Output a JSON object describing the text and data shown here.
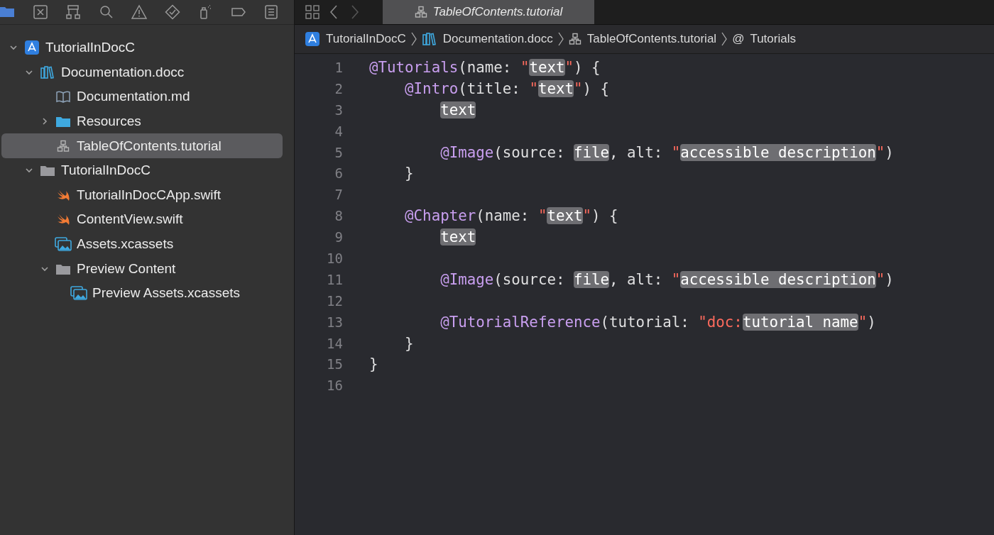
{
  "navigator_toolbar": [
    {
      "kind": "folder",
      "selected": true
    },
    {
      "kind": "source-control",
      "selected": false
    },
    {
      "kind": "hierarchy",
      "selected": false
    },
    {
      "kind": "search",
      "selected": false
    },
    {
      "kind": "warning",
      "selected": false
    },
    {
      "kind": "test",
      "selected": false
    },
    {
      "kind": "debug",
      "selected": false
    },
    {
      "kind": "breakpoint",
      "selected": false
    },
    {
      "kind": "report",
      "selected": false
    }
  ],
  "tree": [
    {
      "label": "TutorialInDocC",
      "kind": "project",
      "expanded": true,
      "selected": false,
      "children": [
        {
          "label": "Documentation.docc",
          "kind": "docc",
          "expanded": true,
          "selected": false,
          "children": [
            {
              "label": "Documentation.md",
              "kind": "book",
              "selected": false
            },
            {
              "label": "Resources",
              "kind": "folder-blue",
              "expanded": false,
              "selected": false
            },
            {
              "label": "TableOfContents.tutorial",
              "kind": "tutorial",
              "selected": true
            }
          ]
        },
        {
          "label": "TutorialInDocC",
          "kind": "folder",
          "expanded": true,
          "selected": false,
          "children": [
            {
              "label": "TutorialInDocCApp.swift",
              "kind": "swift",
              "selected": false
            },
            {
              "label": "ContentView.swift",
              "kind": "swift",
              "selected": false
            },
            {
              "label": "Assets.xcassets",
              "kind": "assets",
              "selected": false
            },
            {
              "label": "Preview Content",
              "kind": "folder",
              "expanded": true,
              "selected": false,
              "children": [
                {
                  "label": "Preview Assets.xcassets",
                  "kind": "assets",
                  "selected": false
                }
              ]
            }
          ]
        }
      ]
    }
  ],
  "editor_tabs": [
    {
      "label": "TableOfContents.tutorial",
      "kind": "tutorial",
      "selected": true
    }
  ],
  "breadcrumb": [
    {
      "label": "TutorialInDocC",
      "kind": "project"
    },
    {
      "label": "Documentation.docc",
      "kind": "docc"
    },
    {
      "label": "TableOfContents.tutorial",
      "kind": "tutorial"
    },
    {
      "label": "Tutorials",
      "kind": "at",
      "symbol": "@"
    }
  ],
  "code_lines": [
    {
      "number": "1",
      "tokens": [
        {
          "kind": "keyword",
          "text": "@Tutorials"
        },
        {
          "kind": "plain",
          "text": "(name: "
        },
        {
          "kind": "string",
          "text": "\""
        },
        {
          "kind": "placeholder",
          "text": "text"
        },
        {
          "kind": "string",
          "text": "\""
        },
        {
          "kind": "plain",
          "text": ") {"
        }
      ],
      "children": [
        {
          "number": "2",
          "tokens": [
            {
              "kind": "keyword",
              "text": "@Intro"
            },
            {
              "kind": "plain",
              "text": "(title: "
            },
            {
              "kind": "string",
              "text": "\""
            },
            {
              "kind": "placeholder",
              "text": "text"
            },
            {
              "kind": "string",
              "text": "\""
            },
            {
              "kind": "plain",
              "text": ") {"
            }
          ],
          "children": [
            {
              "number": "3",
              "tokens": [
                {
                  "kind": "placeholder",
                  "text": "text"
                }
              ]
            },
            {
              "number": "4"
            },
            {
              "number": "5",
              "tokens": [
                {
                  "kind": "keyword",
                  "text": "@Image"
                },
                {
                  "kind": "plain",
                  "text": "(source: "
                },
                {
                  "kind": "placeholder",
                  "text": "file"
                },
                {
                  "kind": "plain",
                  "text": ", alt: "
                },
                {
                  "kind": "string",
                  "text": "\""
                },
                {
                  "kind": "placeholder",
                  "text": "accessible description"
                },
                {
                  "kind": "string",
                  "text": "\""
                },
                {
                  "kind": "plain",
                  "text": ")"
                }
              ]
            }
          ]
        },
        {
          "number": "6",
          "tokens": [
            {
              "kind": "plain",
              "text": "}"
            }
          ]
        },
        {
          "number": "7"
        },
        {
          "number": "8",
          "tokens": [
            {
              "kind": "keyword",
              "text": "@Chapter"
            },
            {
              "kind": "plain",
              "text": "(name: "
            },
            {
              "kind": "string",
              "text": "\""
            },
            {
              "kind": "placeholder",
              "text": "text"
            },
            {
              "kind": "string",
              "text": "\""
            },
            {
              "kind": "plain",
              "text": ") {"
            }
          ],
          "children": [
            {
              "number": "9",
              "tokens": [
                {
                  "kind": "placeholder",
                  "text": "text"
                }
              ]
            },
            {
              "number": "10"
            },
            {
              "number": "11",
              "tokens": [
                {
                  "kind": "keyword",
                  "text": "@Image"
                },
                {
                  "kind": "plain",
                  "text": "(source: "
                },
                {
                  "kind": "placeholder",
                  "text": "file"
                },
                {
                  "kind": "plain",
                  "text": ", alt: "
                },
                {
                  "kind": "string",
                  "text": "\""
                },
                {
                  "kind": "placeholder",
                  "text": "accessible description"
                },
                {
                  "kind": "string",
                  "text": "\""
                },
                {
                  "kind": "plain",
                  "text": ")"
                }
              ]
            },
            {
              "number": "12"
            },
            {
              "number": "13",
              "tokens": [
                {
                  "kind": "keyword",
                  "text": "@TutorialReference"
                },
                {
                  "kind": "plain",
                  "text": "(tutorial: "
                },
                {
                  "kind": "string",
                  "text": "\"doc:"
                },
                {
                  "kind": "placeholder",
                  "text": "tutorial name"
                },
                {
                  "kind": "string",
                  "text": "\""
                },
                {
                  "kind": "plain",
                  "text": ")"
                }
              ]
            }
          ]
        },
        {
          "number": "14",
          "tokens": [
            {
              "kind": "plain",
              "text": "}"
            }
          ]
        }
      ]
    },
    {
      "number": "15",
      "tokens": [
        {
          "kind": "plain",
          "text": "}"
        }
      ]
    },
    {
      "number": "16"
    }
  ]
}
